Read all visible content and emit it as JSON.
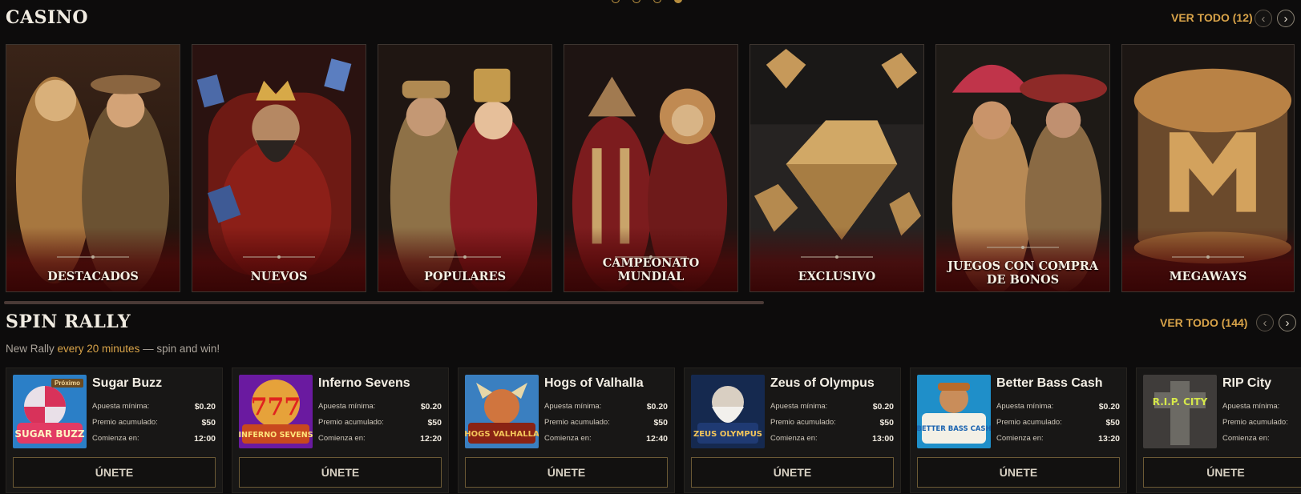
{
  "casino": {
    "title": "CASINO",
    "view_all": "VER TODO (12)",
    "prev_icon": "‹",
    "next_icon": "›",
    "tiles": [
      {
        "label": "DESTACADOS"
      },
      {
        "label": "NUEVOS"
      },
      {
        "label": "POPULARES"
      },
      {
        "label": "CAMPEONATO MUNDIAL"
      },
      {
        "label": "EXCLUSIVO"
      },
      {
        "label": "JUEGOS CON COMPRA DE BONOS"
      },
      {
        "label": "MEGAWAYS"
      }
    ]
  },
  "rally": {
    "title": "SPIN RALLY",
    "view_all": "VER TODO (144)",
    "prev_icon": "‹",
    "next_icon": "›",
    "subtitle_pre": "New Rally ",
    "subtitle_hl": "every 20 minutes",
    "subtitle_post": " — spin and win!",
    "labels": {
      "min_bet": "Apuesta mínima:",
      "prize": "Premio acumulado:",
      "starts": "Comienza en:",
      "join": "ÚNETE"
    },
    "games": [
      {
        "name": "Sugar Buzz",
        "min_bet": "$0.20",
        "prize": "$50",
        "starts": "12:00",
        "badge": "Próximo"
      },
      {
        "name": "Inferno Sevens",
        "min_bet": "$0.20",
        "prize": "$50",
        "starts": "12:20"
      },
      {
        "name": "Hogs of Valhalla",
        "min_bet": "$0.20",
        "prize": "$50",
        "starts": "12:40"
      },
      {
        "name": "Zeus of Olympus",
        "min_bet": "$0.20",
        "prize": "$50",
        "starts": "13:00"
      },
      {
        "name": "Better Bass Cash",
        "min_bet": "$0.20",
        "prize": "$50",
        "starts": "13:20"
      },
      {
        "name": "RIP City",
        "min_bet": "",
        "prize": "",
        "starts": ""
      }
    ]
  },
  "thumb_texts": [
    "SUGAR BUZZ",
    "INFERNO SEVENS",
    "HOGS VALHALLA",
    "ZEUS OLYMPUS",
    "BETTER BASS CASH",
    "R.I.P. CITY"
  ],
  "colors": {
    "accent": "#d8a349",
    "background": "#0d0c0c",
    "card": "#181716"
  }
}
